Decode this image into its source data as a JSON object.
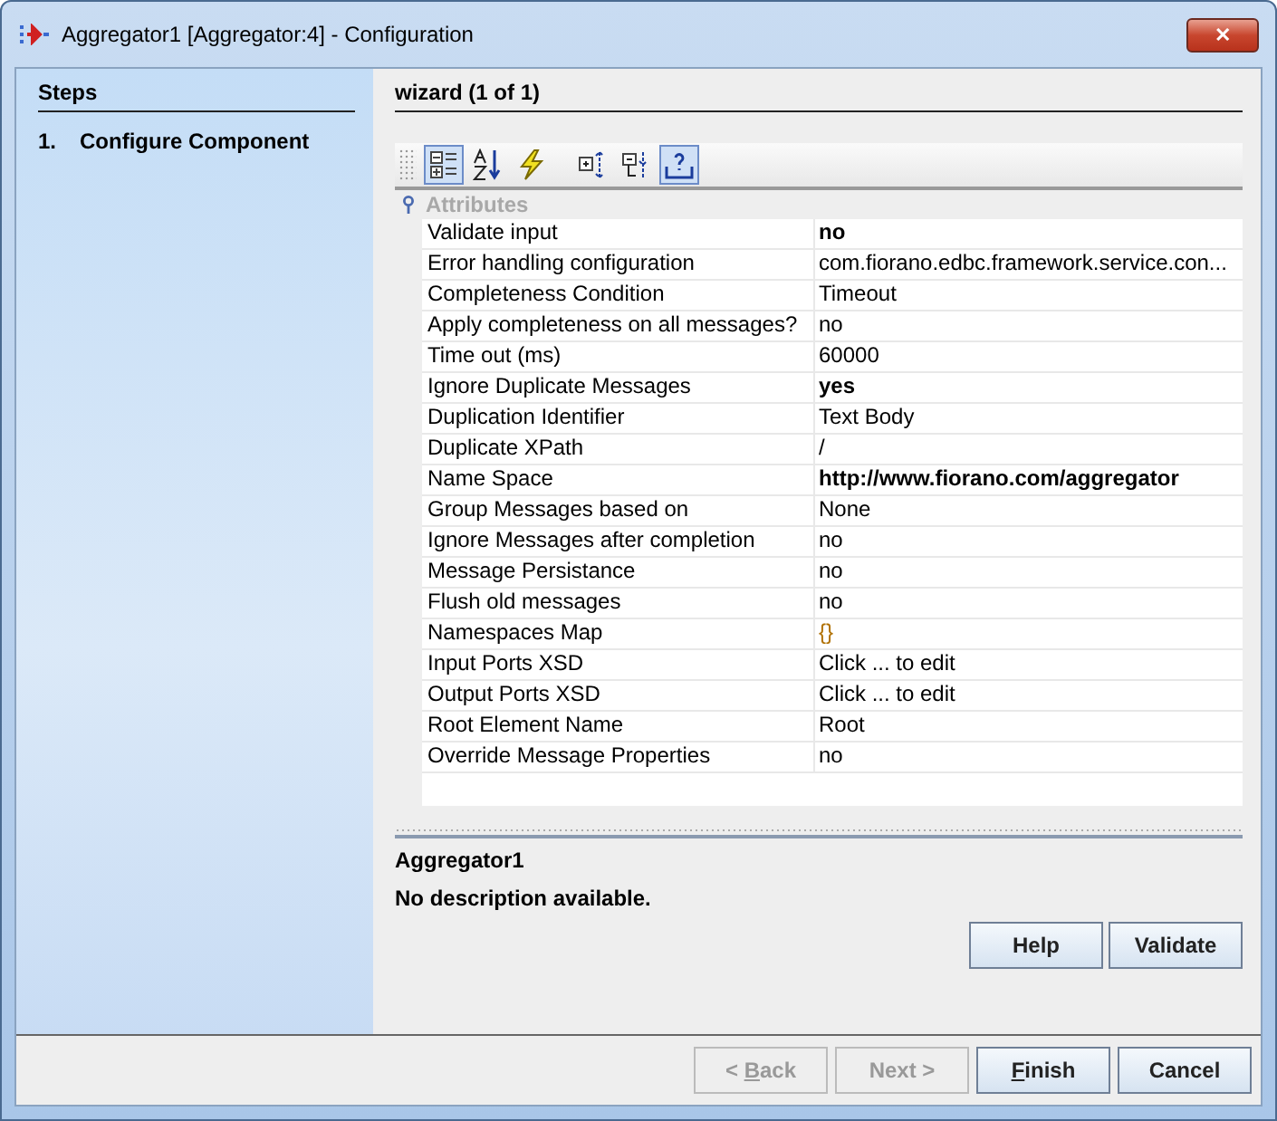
{
  "window": {
    "title": "Aggregator1 [Aggregator:4] - Configuration",
    "close": "✕"
  },
  "steps": {
    "heading": "Steps",
    "items": [
      {
        "number": "1.",
        "label": "Configure Component",
        "selected": true
      }
    ]
  },
  "wizard": {
    "heading": "wizard (1 of 1)"
  },
  "toolbar": [
    {
      "kind": "categorized",
      "selected": true
    },
    {
      "kind": "sort",
      "selected": false
    },
    {
      "kind": "lightning",
      "selected": false
    },
    {
      "kind": "separator"
    },
    {
      "kind": "expand",
      "selected": false
    },
    {
      "kind": "collapse",
      "selected": false
    },
    {
      "kind": "help",
      "selected": true
    }
  ],
  "attributes": {
    "category": "Attributes",
    "rows": [
      {
        "name": "Validate input",
        "value": "no",
        "bold": true
      },
      {
        "name": "Error handling configuration",
        "value": "com.fiorano.edbc.framework.service.con...",
        "bold": false
      },
      {
        "name": "Completeness Condition",
        "value": "Timeout",
        "bold": false
      },
      {
        "name": "Apply completeness on all messages?",
        "value": "no",
        "bold": false
      },
      {
        "name": "Time out (ms)",
        "value": "60000",
        "bold": false
      },
      {
        "name": "Ignore Duplicate Messages",
        "value": "yes",
        "bold": true
      },
      {
        "name": "Duplication Identifier",
        "value": "Text Body",
        "bold": false
      },
      {
        "name": "Duplicate XPath",
        "value": "/",
        "bold": false
      },
      {
        "name": "Name Space",
        "value": "http://www.fiorano.com/aggregator",
        "bold": true
      },
      {
        "name": "Group Messages based on",
        "value": "None",
        "bold": false
      },
      {
        "name": "Ignore Messages after completion",
        "value": "no",
        "bold": false
      },
      {
        "name": "Message Persistance",
        "value": "no",
        "bold": false
      },
      {
        "name": "Flush old messages",
        "value": "no",
        "bold": false
      },
      {
        "name": "Namespaces Map",
        "value": "{}",
        "bold": false,
        "color": "#b07000"
      },
      {
        "name": "Input Ports XSD",
        "value": "Click ... to edit",
        "bold": false
      },
      {
        "name": "Output Ports XSD",
        "value": "Click ... to edit",
        "bold": false
      },
      {
        "name": "Root Element Name",
        "value": "Root",
        "bold": false
      },
      {
        "name": "Override Message Properties",
        "value": "no",
        "bold": false
      }
    ]
  },
  "description": {
    "title": "Aggregator1",
    "text": "No description available."
  },
  "panel_buttons": [
    {
      "label": "Help"
    },
    {
      "label": "Validate"
    }
  ],
  "footer_buttons": [
    {
      "before": "< ",
      "mnemonic": "B",
      "after": "ack",
      "disabled": true
    },
    {
      "label": "Next >",
      "disabled": true
    },
    {
      "mnemonic": "F",
      "after": "inish",
      "disabled": false
    },
    {
      "label": "Cancel",
      "disabled": false
    }
  ]
}
